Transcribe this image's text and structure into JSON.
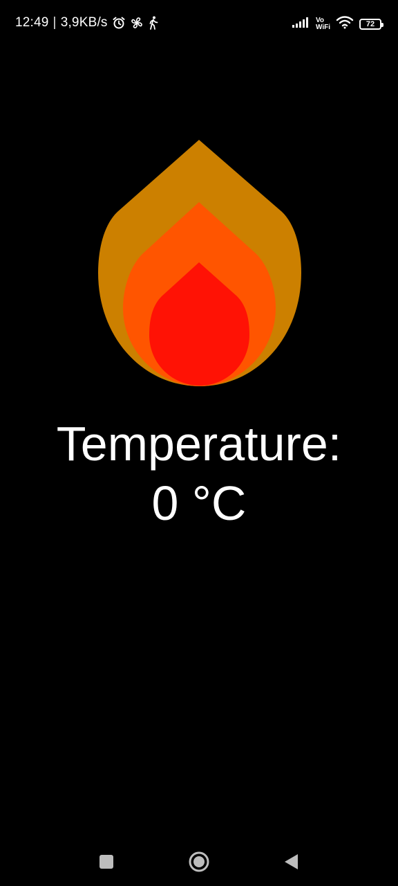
{
  "status_bar": {
    "time": "12:49",
    "separator": "|",
    "network_speed": "3,9KB/s",
    "icons_left": [
      "alarm-icon",
      "fan-icon",
      "walking-icon"
    ],
    "vo_label": "Vo",
    "wifi_label": "WiFi",
    "battery_level": "72"
  },
  "flame": {
    "outer_color": "#CC8000",
    "middle_color": "#FF5500",
    "inner_color": "#FF1205"
  },
  "temperature": {
    "label": "Temperature:",
    "value": "0 °C"
  },
  "nav_bar": {
    "buttons": [
      "recents-button",
      "home-button",
      "back-button"
    ]
  }
}
